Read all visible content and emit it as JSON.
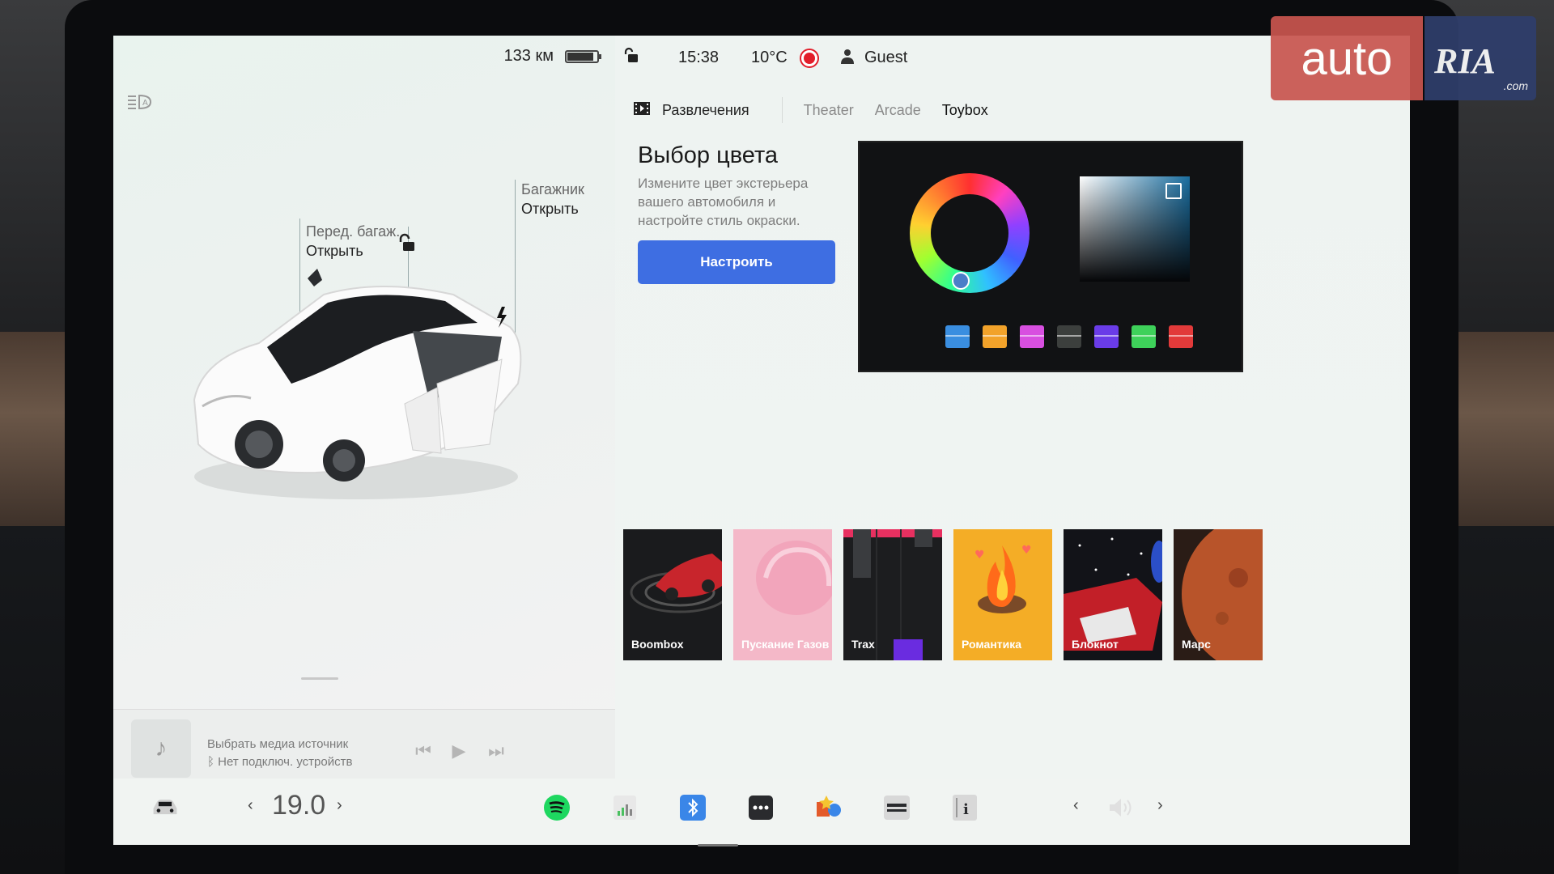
{
  "status": {
    "range": "133 км",
    "range_battery_level": 0.85,
    "time": "15:38",
    "temperature": "10°C",
    "user": "Guest"
  },
  "car_view": {
    "frunk_label": "Перед. багаж.",
    "frunk_action": "Открыть",
    "trunk_label": "Багажник",
    "trunk_action": "Открыть"
  },
  "media": {
    "source_label": "Выбрать медиа источник",
    "device_status": "Нет подключ. устройств"
  },
  "entertainment": {
    "home_label": "Развлечения",
    "tabs": [
      "Theater",
      "Arcade",
      "Toybox"
    ],
    "active_tab": "Toybox"
  },
  "feature": {
    "title": "Выбор цвета",
    "description": "Измените цвет экстерьера вашего автомобиля и настройте стиль окраски.",
    "button": "Настроить"
  },
  "color_picker": {
    "swatches": [
      "#3a8ee0",
      "#f2a22a",
      "#d84fe0",
      "#3c3f3d",
      "#6a3ce8",
      "#3ed15a",
      "#e23a3a"
    ]
  },
  "apps": [
    {
      "label": "Boombox"
    },
    {
      "label": "Пускание Газов"
    },
    {
      "label": "Trax"
    },
    {
      "label": "Романтика"
    },
    {
      "label": "Блокнот"
    },
    {
      "label": "Марс"
    }
  ],
  "taskbar": {
    "cabin_temp": "19.0"
  },
  "watermark": {
    "auto": "auto",
    "ria": "RIA",
    "com": ".com"
  }
}
